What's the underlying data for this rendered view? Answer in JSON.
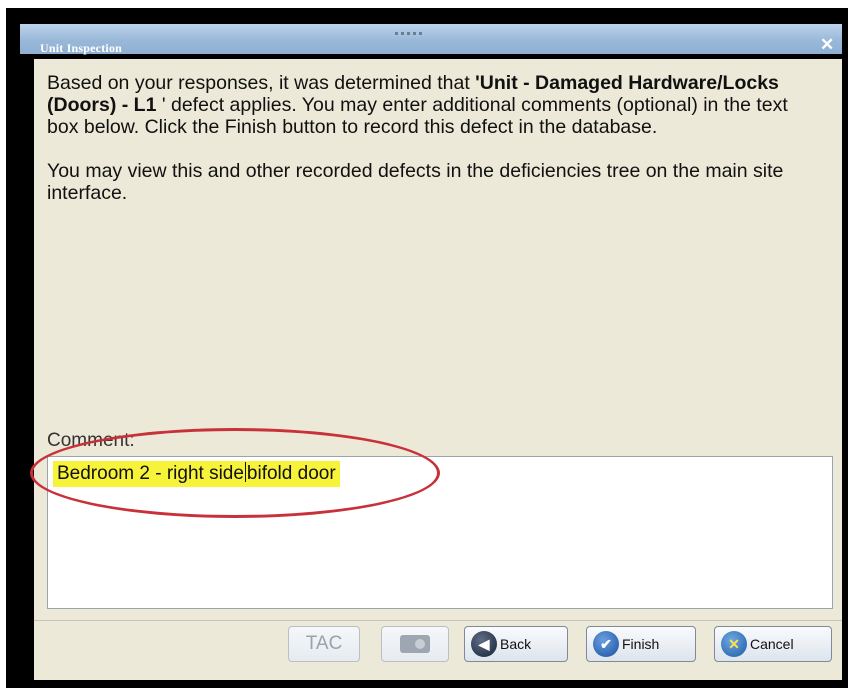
{
  "dialog": {
    "title": "Unit Inspection",
    "close_icon": "close-icon"
  },
  "message": {
    "intro": "Based on your responses, it was determined that ",
    "quote_open": "'",
    "defect_part1": "Unit",
    "dash": " - ",
    "defect_part2": "Damaged Hardware/Locks (Doors)",
    "dash2": " - ",
    "defect_level": "L1",
    "quote_close": " '",
    "rest": " defect applies. You may enter additional comments (optional) in the text box below. Click the Finish button to record this defect in the database.",
    "paragraph2": "You may view this and other recorded defects in the deficiencies tree on the main site interface."
  },
  "comment": {
    "label": "Comment:",
    "text_before_caret": "Bedroom 2 - right side",
    "text_after_caret": "bifold door"
  },
  "buttons": {
    "tac_label": "TAC",
    "camera_icon": "camera-icon",
    "back_label": "Back",
    "finish_label": "Finish",
    "cancel_label": "Cancel"
  },
  "colors": {
    "highlight": "#f7f23a",
    "annotation_ellipse": "#c8303a",
    "titlebar": "#99b8d9",
    "panel": "#ece9d8"
  }
}
